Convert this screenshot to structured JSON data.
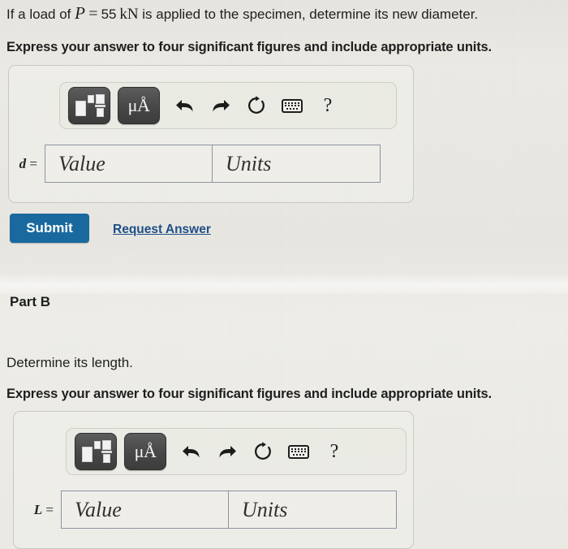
{
  "part_a": {
    "question_prefix": "If a load of ",
    "math_variable": "P",
    "math_equals": "=",
    "math_value": "55",
    "math_unit": "kN",
    "question_suffix": " is applied to the specimen, determine its new diameter.",
    "instruction": "Express your answer to four significant figures and include appropriate units.",
    "field_label_symbol": "d",
    "field_label_equals": "=",
    "value_placeholder": "Value",
    "units_placeholder": "Units",
    "submit_label": "Submit",
    "request_answer_label": "Request Answer"
  },
  "part_b": {
    "title": "Part B",
    "question": "Determine its length.",
    "instruction": "Express your answer to four significant figures and include appropriate units.",
    "field_label_symbol": "L",
    "field_label_equals": "=",
    "value_placeholder": "Value",
    "units_placeholder": "Units"
  },
  "toolbar": {
    "template_icon": "math-template-icon",
    "units_label": "μÅ",
    "undo_icon": "undo-arrow-icon",
    "redo_icon": "redo-arrow-icon",
    "reset_icon": "reset-circular-arrow-icon",
    "keyboard_icon": "keyboard-icon",
    "help_label": "?"
  },
  "colors": {
    "submit_blue": "#19699e",
    "link_blue": "#1f4f87",
    "toolbar_button_dark": "#474747",
    "input_border": "#8d93a1",
    "panel_border": "#c9c8c2",
    "page_background": "#e9e8e2"
  }
}
